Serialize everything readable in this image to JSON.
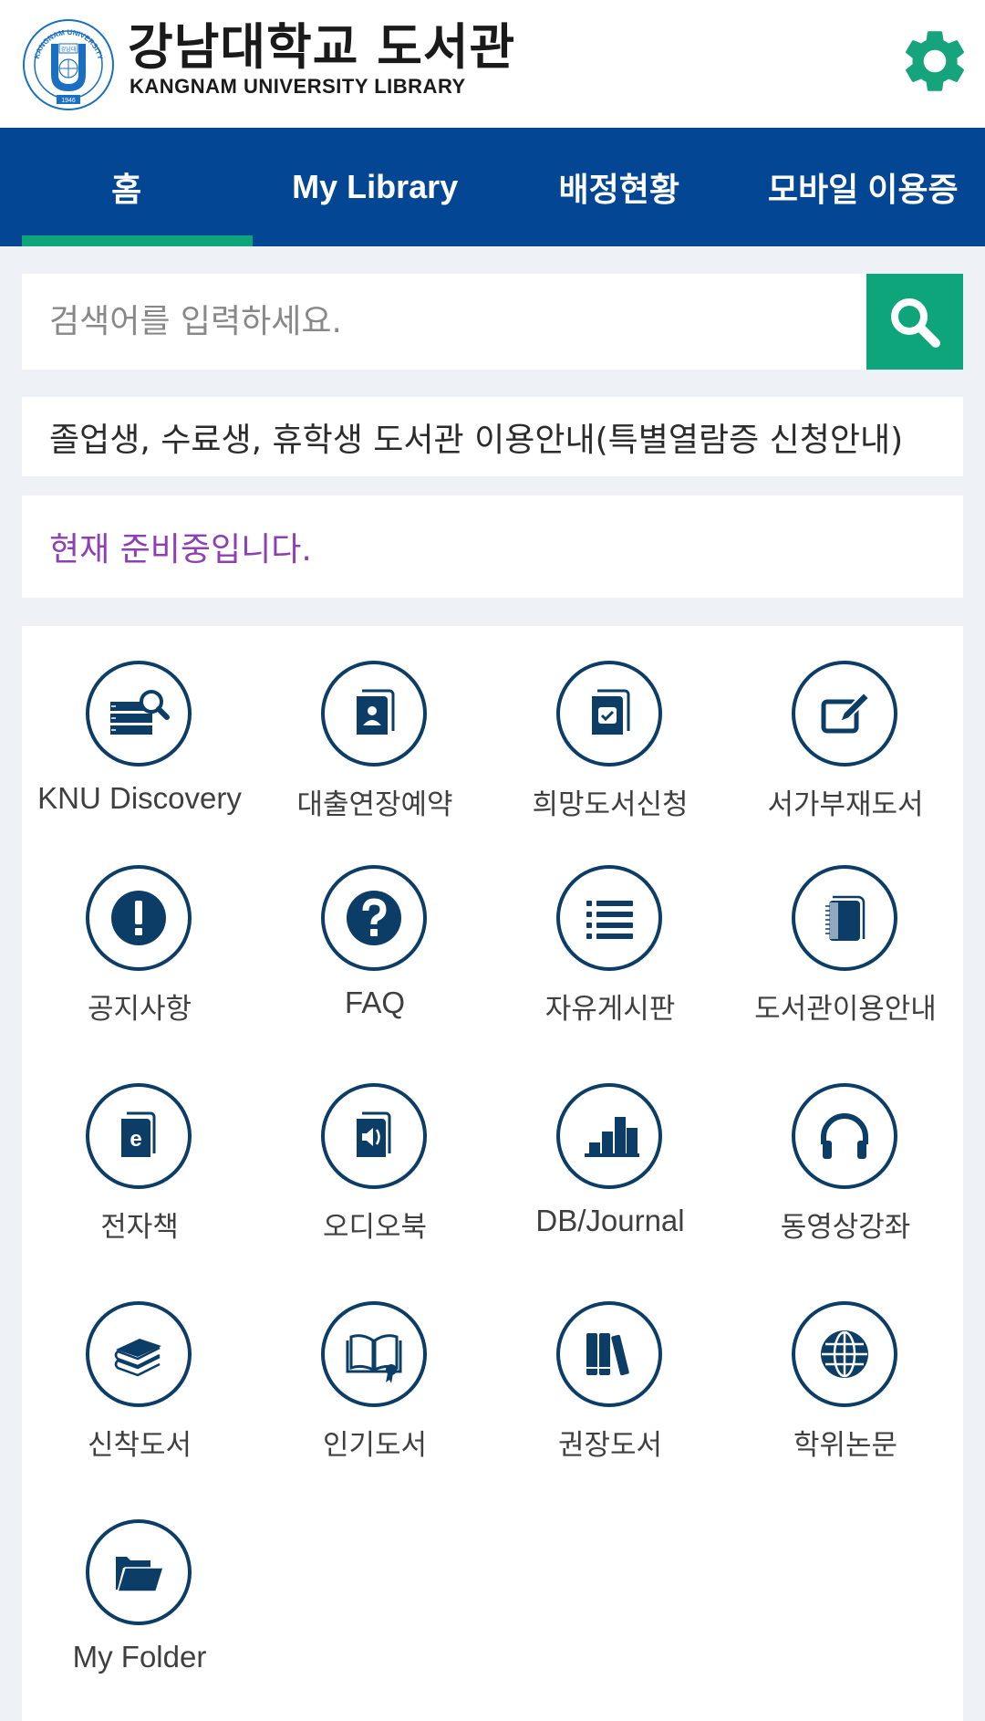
{
  "header": {
    "title_ko": "강남대학교 도서관",
    "title_en": "KANGNAM UNIVERSITY LIBRARY",
    "logo_text_top": "KANGNAM UNIVERSITY",
    "logo_year": "1946",
    "logo_inner": "강남대",
    "settings_icon": "gear-icon"
  },
  "nav": {
    "tabs": [
      {
        "label": "홈",
        "active": true
      },
      {
        "label": "My Library",
        "active": false
      },
      {
        "label": "배정현황",
        "active": false
      },
      {
        "label": "모바일 이용증",
        "active": false
      }
    ]
  },
  "search": {
    "placeholder": "검색어를 입력하세요.",
    "value": "",
    "button_icon": "search-icon"
  },
  "notices": [
    {
      "text": "졸업생, 수료생, 휴학생 도서관 이용안내(특별열람증 신청안내)"
    },
    {
      "text": "현재 준비중입니다."
    }
  ],
  "menu": [
    {
      "label": "KNU Discovery",
      "icon": "database-search-icon"
    },
    {
      "label": "대출연장예약",
      "icon": "contact-book-icon"
    },
    {
      "label": "희망도서신청",
      "icon": "book-check-icon"
    },
    {
      "label": "서가부재도서",
      "icon": "edit-icon"
    },
    {
      "label": "공지사항",
      "icon": "exclamation-icon"
    },
    {
      "label": "FAQ",
      "icon": "question-icon"
    },
    {
      "label": "자유게시판",
      "icon": "list-icon"
    },
    {
      "label": "도서관이용안내",
      "icon": "notebook-icon"
    },
    {
      "label": "전자책",
      "icon": "ebook-icon"
    },
    {
      "label": "오디오북",
      "icon": "audiobook-icon"
    },
    {
      "label": "DB/Journal",
      "icon": "bar-chart-icon"
    },
    {
      "label": "동영상강좌",
      "icon": "headphones-icon"
    },
    {
      "label": "신착도서",
      "icon": "book-stack-icon"
    },
    {
      "label": "인기도서",
      "icon": "open-book-award-icon"
    },
    {
      "label": "권장도서",
      "icon": "books-shelf-icon"
    },
    {
      "label": "학위논문",
      "icon": "globe-icon"
    },
    {
      "label": "My Folder",
      "icon": "folder-open-icon"
    }
  ],
  "colors": {
    "nav_bg": "#034694",
    "accent_green": "#0fa57b",
    "icon_navy": "#0c3d66",
    "notice_purple": "#8e3fb3",
    "page_bg": "#eef1f5"
  }
}
